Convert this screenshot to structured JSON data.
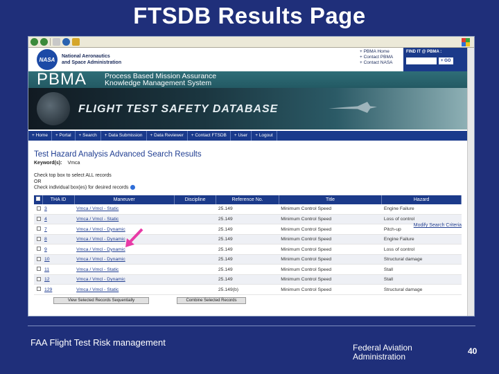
{
  "slide": {
    "title": "FTSDB Results Page",
    "footer_left": "FAA Flight Test Risk management",
    "footer_org_line1": "Federal Aviation",
    "footer_org_line2": "Administration",
    "page_number": "40"
  },
  "site": {
    "nasa_logo": "NASA",
    "nasa_line1": "National Aeronautics",
    "nasa_line2": "and Space Administration",
    "top_links": [
      "+ PBMA Home",
      "+ Contact PBMA",
      "+ Contact NASA"
    ],
    "find_label": "FIND IT @ PBMA :",
    "find_go": "+ GO",
    "pbma_logo": "PBMA",
    "pbma_line1": "Process Based Mission Assurance",
    "pbma_line2": "Knowledge Management System",
    "banner_title": "FLIGHT TEST SAFETY DATABASE",
    "nav": [
      "+ Home",
      "+ Portal",
      "+ Search",
      "+ Data Submission",
      "+ Data Reviewer",
      "+ Contact FTSDB",
      "+ User",
      "+ Logout"
    ]
  },
  "results": {
    "title": "Test Hazard Analysis Advanced Search Results",
    "keyword_label": "Keyword(s):",
    "keyword_value": "Vmca",
    "check_line1": "Check top box to select ALL records",
    "check_line2": "OR",
    "check_line3": "Check individual box(es) for desired records",
    "modify_link": "Modify Search Criteria",
    "columns": [
      "THA ID",
      "Maneuver",
      "Discipline",
      "Reference No.",
      "Title",
      "Hazard"
    ],
    "rows": [
      {
        "id": "3",
        "maneuver": "Vmca / Vmcl - Static",
        "discipline": "",
        "ref": "25.149",
        "title": "Minimum Control Speed",
        "hazard": "Engine Failure"
      },
      {
        "id": "4",
        "maneuver": "Vmca / Vmcl - Static",
        "discipline": "",
        "ref": "25.149",
        "title": "Minimum Control Speed",
        "hazard": "Loss of control"
      },
      {
        "id": "7",
        "maneuver": "Vmca / Vmcl - Dynamic",
        "discipline": "",
        "ref": "25.149",
        "title": "Minimum Control Speed",
        "hazard": "Pitch-up"
      },
      {
        "id": "8",
        "maneuver": "Vmca / Vmcl - Dynamic",
        "discipline": "",
        "ref": "25.149",
        "title": "Minimum Control Speed",
        "hazard": "Engine Failure"
      },
      {
        "id": "9",
        "maneuver": "Vmca / Vmcl - Dynamic",
        "discipline": "",
        "ref": "25.149",
        "title": "Minimum Control Speed",
        "hazard": "Loss of control"
      },
      {
        "id": "10",
        "maneuver": "Vmca / Vmcl - Dynamic",
        "discipline": "",
        "ref": "25.149",
        "title": "Minimum Control Speed",
        "hazard": "Structural damage"
      },
      {
        "id": "11",
        "maneuver": "Vmca / Vmcl - Static",
        "discipline": "",
        "ref": "25.149",
        "title": "Minimum Control Speed",
        "hazard": "Stall"
      },
      {
        "id": "12",
        "maneuver": "Vmca / Vmcl - Dynamic",
        "discipline": "",
        "ref": "25.149",
        "title": "Minimum Control Speed",
        "hazard": "Stall"
      },
      {
        "id": "129",
        "maneuver": "Vmca / Vmcl - Static",
        "discipline": "",
        "ref": "25.149(b)",
        "title": "Minimum Control Speed",
        "hazard": "Structural damage"
      }
    ],
    "btn_view": "View Selected Records Sequentially",
    "btn_combine": "Combine Selected Records"
  },
  "colors": {
    "slide_bg": "#1f2f7a",
    "nav_bg": "#1a3a8c",
    "pbma_bar": "#2f6e78",
    "arrow": "#e83aa6"
  },
  "icons": [
    "back-icon",
    "forward-icon",
    "stop-icon",
    "refresh-icon",
    "home-icon",
    "windows-logo-icon",
    "info-icon",
    "pointer-arrow-icon"
  ]
}
